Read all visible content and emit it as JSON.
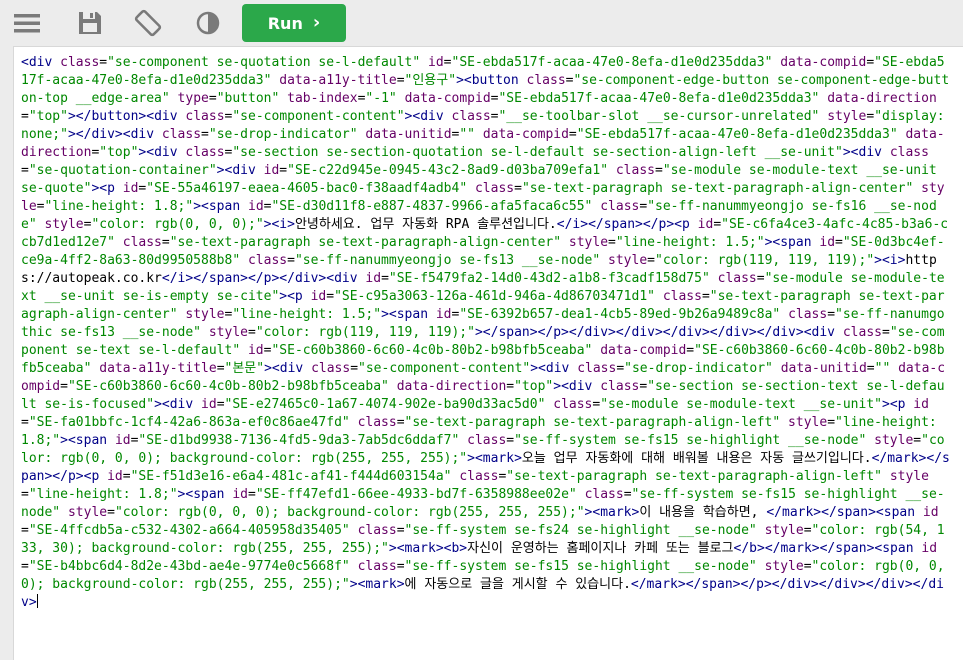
{
  "toolbar": {
    "menu_icon": "hamburger-menu-icon",
    "save_icon": "floppy-disk-icon",
    "rotate_icon": "rotate-device-icon",
    "theme_icon": "contrast-half-circle-icon",
    "run_label": "Run",
    "run_chevron": "›"
  },
  "colors": {
    "run_button": "#2ba84a",
    "toolbar_bg": "#ececec",
    "tag": "#000088",
    "attr": "#660066",
    "value": "#008800"
  },
  "editor": {
    "tokens": [
      [
        "t",
        "<div "
      ],
      [
        "a",
        "class"
      ],
      [
        "x",
        "="
      ],
      [
        "v",
        "\"se-component se-quotation se-l-default\""
      ],
      [
        "x",
        " "
      ],
      [
        "a",
        "id"
      ],
      [
        "x",
        "="
      ],
      [
        "v",
        "\"SE-ebda517f-acaa-47e0-8efa-d1e0d235dda3\""
      ],
      [
        "x",
        " "
      ],
      [
        "a",
        "data-compid"
      ],
      [
        "x",
        "="
      ],
      [
        "v",
        "\"SE-ebda517f-acaa-47e0-8efa-d1e0d235dda3\""
      ],
      [
        "x",
        " "
      ],
      [
        "a",
        "data-a11y-title"
      ],
      [
        "x",
        "="
      ],
      [
        "v",
        "\"인용구\""
      ],
      [
        "t",
        ">"
      ],
      [
        "t",
        "<button "
      ],
      [
        "a",
        "class"
      ],
      [
        "x",
        "="
      ],
      [
        "v",
        "\"se-component-edge-button se-component-edge-button-top __edge-area\""
      ],
      [
        "x",
        " "
      ],
      [
        "a",
        "type"
      ],
      [
        "x",
        "="
      ],
      [
        "v",
        "\"button\""
      ],
      [
        "x",
        " "
      ],
      [
        "a",
        "tab-index"
      ],
      [
        "x",
        "="
      ],
      [
        "v",
        "\"-1\""
      ],
      [
        "x",
        " "
      ],
      [
        "a",
        "data-compid"
      ],
      [
        "x",
        "="
      ],
      [
        "v",
        "\"SE-ebda517f-acaa-47e0-8efa-d1e0d235dda3\""
      ],
      [
        "x",
        " "
      ],
      [
        "a",
        "data-direction"
      ],
      [
        "x",
        "="
      ],
      [
        "v",
        "\"top\""
      ],
      [
        "t",
        "></button>"
      ],
      [
        "t",
        "<div "
      ],
      [
        "a",
        "class"
      ],
      [
        "x",
        "="
      ],
      [
        "v",
        "\"se-component-content\""
      ],
      [
        "t",
        ">"
      ],
      [
        "t",
        "<div "
      ],
      [
        "a",
        "class"
      ],
      [
        "x",
        "="
      ],
      [
        "v",
        "\"__se-toolbar-slot __se-cursor-unrelated\""
      ],
      [
        "x",
        " "
      ],
      [
        "a",
        "style"
      ],
      [
        "x",
        "="
      ],
      [
        "v",
        "\"display: none;\""
      ],
      [
        "t",
        "></div>"
      ],
      [
        "t",
        "<div "
      ],
      [
        "a",
        "class"
      ],
      [
        "x",
        "="
      ],
      [
        "v",
        "\"se-drop-indicator\""
      ],
      [
        "x",
        " "
      ],
      [
        "a",
        "data-unitid"
      ],
      [
        "x",
        "="
      ],
      [
        "v",
        "\"\""
      ],
      [
        "x",
        " "
      ],
      [
        "a",
        "data-compid"
      ],
      [
        "x",
        "="
      ],
      [
        "v",
        "\"SE-ebda517f-acaa-47e0-8efa-d1e0d235dda3\""
      ],
      [
        "x",
        " "
      ],
      [
        "a",
        "data-direction"
      ],
      [
        "x",
        "="
      ],
      [
        "v",
        "\"top\""
      ],
      [
        "t",
        ">"
      ],
      [
        "t",
        "<div "
      ],
      [
        "a",
        "class"
      ],
      [
        "x",
        "="
      ],
      [
        "v",
        "\"se-section se-section-quotation se-l-default se-section-align-left __se-unit\""
      ],
      [
        "t",
        ">"
      ],
      [
        "t",
        "<div "
      ],
      [
        "a",
        "class"
      ],
      [
        "x",
        "="
      ],
      [
        "v",
        "\"se-quotation-container\""
      ],
      [
        "t",
        ">"
      ],
      [
        "t",
        "<div "
      ],
      [
        "a",
        "id"
      ],
      [
        "x",
        "="
      ],
      [
        "v",
        "\"SE-c22d945e-0945-43c2-8ad9-d03ba709efa1\""
      ],
      [
        "x",
        " "
      ],
      [
        "a",
        "class"
      ],
      [
        "x",
        "="
      ],
      [
        "v",
        "\"se-module se-module-text __se-unit se-quote\""
      ],
      [
        "t",
        ">"
      ],
      [
        "t",
        "<p "
      ],
      [
        "a",
        "id"
      ],
      [
        "x",
        "="
      ],
      [
        "v",
        "\"SE-55a46197-eaea-4605-bac0-f38aadf4adb4\""
      ],
      [
        "x",
        " "
      ],
      [
        "a",
        "class"
      ],
      [
        "x",
        "="
      ],
      [
        "v",
        "\"se-text-paragraph se-text-paragraph-align-center\""
      ],
      [
        "x",
        " "
      ],
      [
        "a",
        "style"
      ],
      [
        "x",
        "="
      ],
      [
        "v",
        "\"line-height: 1.8;\""
      ],
      [
        "t",
        ">"
      ],
      [
        "t",
        "<span "
      ],
      [
        "a",
        "id"
      ],
      [
        "x",
        "="
      ],
      [
        "v",
        "\"SE-d30d11f8-e887-4837-9966-afa5faca6c55\""
      ],
      [
        "x",
        " "
      ],
      [
        "a",
        "class"
      ],
      [
        "x",
        "="
      ],
      [
        "v",
        "\"se-ff-nanummyeongjo se-fs16 __se-node\""
      ],
      [
        "x",
        " "
      ],
      [
        "a",
        "style"
      ],
      [
        "x",
        "="
      ],
      [
        "v",
        "\"color: rgb(0, 0, 0);\""
      ],
      [
        "t",
        ">"
      ],
      [
        "t",
        "<i>"
      ],
      [
        "x",
        "안녕하세요. 업무 자동화 RPA 솔루션입니다."
      ],
      [
        "t",
        "</i></span></p>"
      ],
      [
        "t",
        "<p "
      ],
      [
        "a",
        "id"
      ],
      [
        "x",
        "="
      ],
      [
        "v",
        "\"SE-c6fa4ce3-4afc-4c85-b3a6-ccb7d1ed12e7\""
      ],
      [
        "x",
        " "
      ],
      [
        "a",
        "class"
      ],
      [
        "x",
        "="
      ],
      [
        "v",
        "\"se-text-paragraph se-text-paragraph-align-center\""
      ],
      [
        "x",
        " "
      ],
      [
        "a",
        "style"
      ],
      [
        "x",
        "="
      ],
      [
        "v",
        "\"line-height: 1.5;\""
      ],
      [
        "t",
        ">"
      ],
      [
        "t",
        "<span "
      ],
      [
        "a",
        "id"
      ],
      [
        "x",
        "="
      ],
      [
        "v",
        "\"SE-0d3bc4ef-ce9a-4ff2-8a63-80d9950588b8\""
      ],
      [
        "x",
        " "
      ],
      [
        "a",
        "class"
      ],
      [
        "x",
        "="
      ],
      [
        "v",
        "\"se-ff-nanummyeongjo se-fs13 __se-node\""
      ],
      [
        "x",
        " "
      ],
      [
        "a",
        "style"
      ],
      [
        "x",
        "="
      ],
      [
        "v",
        "\"color: rgb(119, 119, 119);\""
      ],
      [
        "t",
        ">"
      ],
      [
        "t",
        "<i>"
      ],
      [
        "x",
        "https://autopeak.co.kr"
      ],
      [
        "t",
        "</i></span></p></div>"
      ],
      [
        "t",
        "<div "
      ],
      [
        "a",
        "id"
      ],
      [
        "x",
        "="
      ],
      [
        "v",
        "\"SE-f5479fa2-14d0-43d2-a1b8-f3cadf158d75\""
      ],
      [
        "x",
        " "
      ],
      [
        "a",
        "class"
      ],
      [
        "x",
        "="
      ],
      [
        "v",
        "\"se-module se-module-text __se-unit se-is-empty se-cite\""
      ],
      [
        "t",
        ">"
      ],
      [
        "t",
        "<p "
      ],
      [
        "a",
        "id"
      ],
      [
        "x",
        "="
      ],
      [
        "v",
        "\"SE-c95a3063-126a-461d-946a-4d86703471d1\""
      ],
      [
        "x",
        " "
      ],
      [
        "a",
        "class"
      ],
      [
        "x",
        "="
      ],
      [
        "v",
        "\"se-text-paragraph se-text-paragraph-align-center\""
      ],
      [
        "x",
        " "
      ],
      [
        "a",
        "style"
      ],
      [
        "x",
        "="
      ],
      [
        "v",
        "\"line-height: 1.5;\""
      ],
      [
        "t",
        ">"
      ],
      [
        "t",
        "<span "
      ],
      [
        "a",
        "id"
      ],
      [
        "x",
        "="
      ],
      [
        "v",
        "\"SE-6392b657-dea1-4cb5-89ed-9b26a9489c8a\""
      ],
      [
        "x",
        " "
      ],
      [
        "a",
        "class"
      ],
      [
        "x",
        "="
      ],
      [
        "v",
        "\"se-ff-nanumgothic se-fs13 __se-node\""
      ],
      [
        "x",
        " "
      ],
      [
        "a",
        "style"
      ],
      [
        "x",
        "="
      ],
      [
        "v",
        "\"color: rgb(119, 119, 119);\""
      ],
      [
        "t",
        "></span></p></div></div></div></div></div>"
      ],
      [
        "t",
        "<div "
      ],
      [
        "a",
        "class"
      ],
      [
        "x",
        "="
      ],
      [
        "v",
        "\"se-component se-text se-l-default\""
      ],
      [
        "x",
        " "
      ],
      [
        "a",
        "id"
      ],
      [
        "x",
        "="
      ],
      [
        "v",
        "\"SE-c60b3860-6c60-4c0b-80b2-b98bfb5ceaba\""
      ],
      [
        "x",
        " "
      ],
      [
        "a",
        "data-compid"
      ],
      [
        "x",
        "="
      ],
      [
        "v",
        "\"SE-c60b3860-6c60-4c0b-80b2-b98bfb5ceaba\""
      ],
      [
        "x",
        " "
      ],
      [
        "a",
        "data-a11y-title"
      ],
      [
        "x",
        "="
      ],
      [
        "v",
        "\"본문\""
      ],
      [
        "t",
        ">"
      ],
      [
        "t",
        "<div "
      ],
      [
        "a",
        "class"
      ],
      [
        "x",
        "="
      ],
      [
        "v",
        "\"se-component-content\""
      ],
      [
        "t",
        ">"
      ],
      [
        "t",
        "<div "
      ],
      [
        "a",
        "class"
      ],
      [
        "x",
        "="
      ],
      [
        "v",
        "\"se-drop-indicator\""
      ],
      [
        "x",
        " "
      ],
      [
        "a",
        "data-unitid"
      ],
      [
        "x",
        "="
      ],
      [
        "v",
        "\"\""
      ],
      [
        "x",
        " "
      ],
      [
        "a",
        "data-compid"
      ],
      [
        "x",
        "="
      ],
      [
        "v",
        "\"SE-c60b3860-6c60-4c0b-80b2-b98bfb5ceaba\""
      ],
      [
        "x",
        " "
      ],
      [
        "a",
        "data-direction"
      ],
      [
        "x",
        "="
      ],
      [
        "v",
        "\"top\""
      ],
      [
        "t",
        ">"
      ],
      [
        "t",
        "<div "
      ],
      [
        "a",
        "class"
      ],
      [
        "x",
        "="
      ],
      [
        "v",
        "\"se-section se-section-text se-l-default se-is-focused\""
      ],
      [
        "t",
        ">"
      ],
      [
        "t",
        "<div "
      ],
      [
        "a",
        "id"
      ],
      [
        "x",
        "="
      ],
      [
        "v",
        "\"SE-e27465c0-1a67-4074-902e-ba90d33ac5d0\""
      ],
      [
        "x",
        " "
      ],
      [
        "a",
        "class"
      ],
      [
        "x",
        "="
      ],
      [
        "v",
        "\"se-module se-module-text __se-unit\""
      ],
      [
        "t",
        ">"
      ],
      [
        "t",
        "<p "
      ],
      [
        "a",
        "id"
      ],
      [
        "x",
        "="
      ],
      [
        "v",
        "\"SE-fa01bbfc-1cf4-42a6-863a-ef0c86ae47fd\""
      ],
      [
        "x",
        " "
      ],
      [
        "a",
        "class"
      ],
      [
        "x",
        "="
      ],
      [
        "v",
        "\"se-text-paragraph se-text-paragraph-align-left\""
      ],
      [
        "x",
        " "
      ],
      [
        "a",
        "style"
      ],
      [
        "x",
        "="
      ],
      [
        "v",
        "\"line-height: 1.8;\""
      ],
      [
        "t",
        ">"
      ],
      [
        "t",
        "<span "
      ],
      [
        "a",
        "id"
      ],
      [
        "x",
        "="
      ],
      [
        "v",
        "\"SE-d1bd9938-7136-4fd5-9da3-7ab5dc6ddaf7\""
      ],
      [
        "x",
        " "
      ],
      [
        "a",
        "class"
      ],
      [
        "x",
        "="
      ],
      [
        "v",
        "\"se-ff-system se-fs15 se-highlight __se-node\""
      ],
      [
        "x",
        " "
      ],
      [
        "a",
        "style"
      ],
      [
        "x",
        "="
      ],
      [
        "v",
        "\"color: rgb(0, 0, 0); background-color: rgb(255, 255, 255);\""
      ],
      [
        "t",
        ">"
      ],
      [
        "t",
        "<mark>"
      ],
      [
        "x",
        "오늘 업무 자동화에 대해 배워볼 내용은 자동 글쓰기입니다."
      ],
      [
        "t",
        "</mark></span></p>"
      ],
      [
        "t",
        "<p "
      ],
      [
        "a",
        "id"
      ],
      [
        "x",
        "="
      ],
      [
        "v",
        "\"SE-f51d3e16-e6a4-481c-af41-f444d603154a\""
      ],
      [
        "x",
        " "
      ],
      [
        "a",
        "class"
      ],
      [
        "x",
        "="
      ],
      [
        "v",
        "\"se-text-paragraph se-text-paragraph-align-left\""
      ],
      [
        "x",
        " "
      ],
      [
        "a",
        "style"
      ],
      [
        "x",
        "="
      ],
      [
        "v",
        "\"line-height: 1.8;\""
      ],
      [
        "t",
        ">"
      ],
      [
        "t",
        "<span "
      ],
      [
        "a",
        "id"
      ],
      [
        "x",
        "="
      ],
      [
        "v",
        "\"SE-ff47efd1-66ee-4933-bd7f-6358988ee02e\""
      ],
      [
        "x",
        " "
      ],
      [
        "a",
        "class"
      ],
      [
        "x",
        "="
      ],
      [
        "v",
        "\"se-ff-system se-fs15 se-highlight __se-node\""
      ],
      [
        "x",
        " "
      ],
      [
        "a",
        "style"
      ],
      [
        "x",
        "="
      ],
      [
        "v",
        "\"color: rgb(0, 0, 0); background-color: rgb(255, 255, 255);\""
      ],
      [
        "t",
        ">"
      ],
      [
        "t",
        "<mark>"
      ],
      [
        "x",
        "이 내용을 학습하면, "
      ],
      [
        "t",
        "</mark></span>"
      ],
      [
        "t",
        "<span "
      ],
      [
        "a",
        "id"
      ],
      [
        "x",
        "="
      ],
      [
        "v",
        "\"SE-4ffcdb5a-c532-4302-a664-405958d35405\""
      ],
      [
        "x",
        " "
      ],
      [
        "a",
        "class"
      ],
      [
        "x",
        "="
      ],
      [
        "v",
        "\"se-ff-system se-fs24 se-highlight __se-node\""
      ],
      [
        "x",
        " "
      ],
      [
        "a",
        "style"
      ],
      [
        "x",
        "="
      ],
      [
        "v",
        "\"color: rgb(54, 133, 30); background-color: rgb(255, 255, 255);\""
      ],
      [
        "t",
        ">"
      ],
      [
        "t",
        "<mark><b>"
      ],
      [
        "x",
        "자신이 운영하는 홈페이지나 카페 또는 블로그"
      ],
      [
        "t",
        "</b></mark></span>"
      ],
      [
        "t",
        "<span "
      ],
      [
        "a",
        "id"
      ],
      [
        "x",
        "="
      ],
      [
        "v",
        "\"SE-b4bbc6d4-8d2e-43bd-ae4e-9774e0c5668f\""
      ],
      [
        "x",
        " "
      ],
      [
        "a",
        "class"
      ],
      [
        "x",
        "="
      ],
      [
        "v",
        "\"se-ff-system se-fs15 se-highlight __se-node\""
      ],
      [
        "x",
        " "
      ],
      [
        "a",
        "style"
      ],
      [
        "x",
        "="
      ],
      [
        "v",
        "\"color: rgb(0, 0, 0); background-color: rgb(255, 255, 255);\""
      ],
      [
        "t",
        ">"
      ],
      [
        "t",
        "<mark>"
      ],
      [
        "x",
        "에 자동으로 글을 게시할 수 있습니다."
      ],
      [
        "t",
        "</mark></span></p></div></div></div></div>"
      ]
    ]
  }
}
